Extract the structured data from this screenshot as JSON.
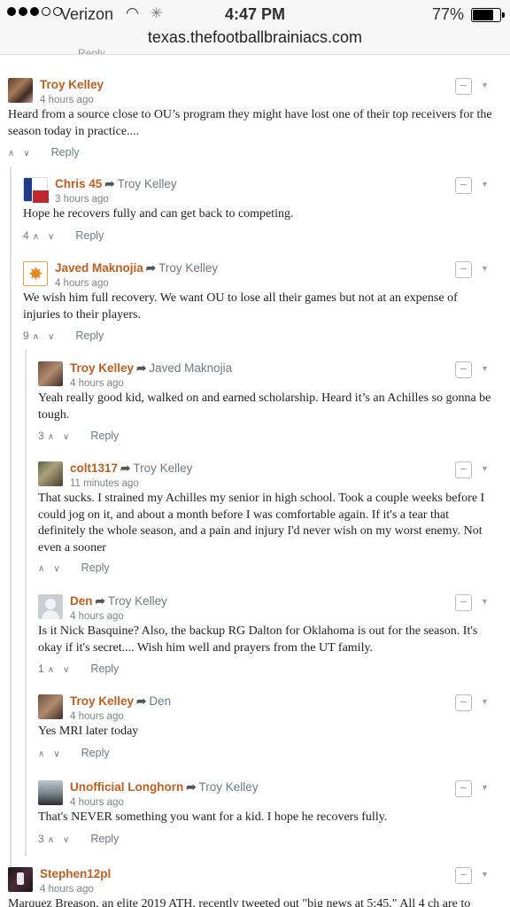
{
  "status_bar": {
    "carrier": "Verizon",
    "time": "4:47 PM",
    "battery": "77%",
    "battery_level": 0.77
  },
  "address_bar": {
    "url": "texas.thefootballbrainiacs.com"
  },
  "partial_reply": "Reply",
  "comments": [
    {
      "author": "Troy Kelley",
      "reply_to": "",
      "time": "4 hours ago",
      "avatar_icon": "user-photo-avatar",
      "text": "Heard from a source close to OU’s program they might have lost one of their top receivers for the season today in practice....",
      "votes": "",
      "reply_label": "Reply",
      "collapse_label": "−"
    },
    {
      "author": "Chris 45",
      "reply_to": "Troy Kelley",
      "time": "3 hours ago",
      "avatar_icon": "texas-flag-avatar",
      "text": "Hope he recovers fully and can get back to competing.",
      "votes": "4",
      "reply_label": "Reply",
      "collapse_label": "−"
    },
    {
      "author": "Javed Maknojia",
      "reply_to": "Troy Kelley",
      "time": "4 hours ago",
      "avatar_icon": "orange-emblem-avatar",
      "text": "We wish him full recovery. We want OU to lose all their games but not at an expense of injuries to their players.",
      "votes": "9",
      "reply_label": "Reply",
      "collapse_label": "−"
    },
    {
      "author": "Troy Kelley",
      "reply_to": "Javed Maknojia",
      "time": "4 hours ago",
      "avatar_icon": "user-photo-avatar",
      "text": "Yeah really good kid, walked on and earned scholarship. Heard it’s an Achilles so gonna be tough.",
      "votes": "3",
      "reply_label": "Reply",
      "collapse_label": "−"
    },
    {
      "author": "colt1317",
      "reply_to": "Troy Kelley",
      "time": "11 minutes ago",
      "avatar_icon": "user-photo-avatar",
      "text": "That sucks. I strained my Achilles my senior in high school. Took a couple weeks before I could jog on it, and about a month before I was comfortable again. If it's a tear that definitely the whole season, and a pain and injury I'd never wish on my worst enemy. Not even a sooner",
      "votes": "",
      "reply_label": "Reply",
      "collapse_label": "−"
    },
    {
      "author": "Den",
      "reply_to": "Troy Kelley",
      "time": "4 hours ago",
      "avatar_icon": "default-user-avatar",
      "text": "Is it Nick Basquine? Also, the backup RG Dalton for Oklahoma is out for the season. It's okay if it's secret.... Wish him well and prayers from the UT family.",
      "votes": "1",
      "reply_label": "Reply",
      "collapse_label": "−"
    },
    {
      "author": "Troy Kelley",
      "reply_to": "Den",
      "time": "4 hours ago",
      "avatar_icon": "user-photo-avatar",
      "text": "Yes MRI later today",
      "votes": "",
      "reply_label": "Reply",
      "collapse_label": "−"
    },
    {
      "author": "Unofficial Longhorn",
      "reply_to": "Troy Kelley",
      "time": "4 hours ago",
      "avatar_icon": "user-photo-avatar",
      "text": "That's NEVER something you want for a kid. I hope he recovers fully.",
      "votes": "3",
      "reply_label": "Reply",
      "collapse_label": "−"
    },
    {
      "author": "Stephen12pl",
      "reply_to": "",
      "time": "4 hours ago",
      "avatar_icon": "user-photo-avatar",
      "text": "Marquez Breason, an elite 2019 ATH, recently tweeted out \"big news at 5:45.\" All 4 ch are to",
      "votes": "",
      "reply_label": "",
      "collapse_label": "−"
    }
  ],
  "colors": {
    "author": "#c15d1e",
    "meta": "#7b848a",
    "thread_line": "#dcdfe2"
  }
}
